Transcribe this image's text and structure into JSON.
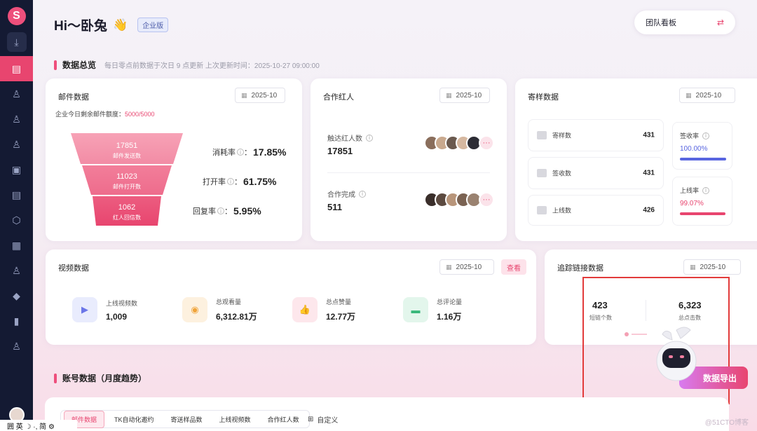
{
  "sidebar": {
    "logo": "S",
    "items": [
      {
        "icon": "download-icon",
        "glyph": "⤓"
      },
      {
        "icon": "dashboard-icon",
        "glyph": "▤"
      },
      {
        "icon": "user-icon",
        "glyph": "♙"
      },
      {
        "icon": "user-group-icon",
        "glyph": "♙"
      },
      {
        "icon": "user-search-icon",
        "glyph": "♙"
      },
      {
        "icon": "wallet-icon",
        "glyph": "▣"
      },
      {
        "icon": "document-icon",
        "glyph": "▤"
      },
      {
        "icon": "box-icon",
        "glyph": "⬡"
      },
      {
        "icon": "image-icon",
        "glyph": "▦"
      },
      {
        "icon": "person-star-icon",
        "glyph": "♙"
      },
      {
        "icon": "diamond-icon",
        "glyph": "◆"
      },
      {
        "icon": "chart-icon",
        "glyph": "▮"
      },
      {
        "icon": "profile-icon",
        "glyph": "♙"
      }
    ]
  },
  "header": {
    "greeting": "Hi～卧兔",
    "wave": "👋",
    "badge": "企业版",
    "team_select": "团队看板",
    "swap_icon": "⇄"
  },
  "overview": {
    "title": "数据总览",
    "subtitle": "每日零点前数据于次日 9 点更新 上次更新时间：2025-10-27 09:00:00"
  },
  "mail": {
    "title": "邮件数据",
    "date": "2025-10",
    "quota_label": "企业今日剩余邮件额度：",
    "quota_value": "5000/5000",
    "funnel": [
      {
        "value": "17851",
        "label": "邮件发送数"
      },
      {
        "value": "11023",
        "label": "邮件打开数"
      },
      {
        "value": "1062",
        "label": "红人回信数"
      }
    ],
    "rates": [
      {
        "label": "消耗率",
        "value": "17.85%"
      },
      {
        "label": "打开率",
        "value": "61.75%"
      },
      {
        "label": "回复率",
        "value": "5.95%"
      }
    ]
  },
  "kol": {
    "title": "合作红人",
    "date": "2025-10",
    "reached_label": "触达红人数",
    "reached_value": "17851",
    "completed_label": "合作完成",
    "completed_value": "511",
    "more": "···"
  },
  "sample": {
    "title": "寄样数据",
    "date": "2025-10",
    "stats": [
      {
        "label": "寄样数",
        "value": "431"
      },
      {
        "label": "签收数",
        "value": "431"
      },
      {
        "label": "上线数",
        "value": "426"
      }
    ],
    "rates": [
      {
        "label": "签收率",
        "value": "100.00%",
        "color": "#5865e0",
        "fill": 1.0
      },
      {
        "label": "上线率",
        "value": "99.07%",
        "color": "#e8456f",
        "fill": 0.9907
      }
    ]
  },
  "video": {
    "title": "视频数据",
    "date": "2025-10",
    "view_button": "查看",
    "stats": [
      {
        "label": "上线视频数",
        "value": "1,009",
        "icon": "video-icon",
        "glyph": "▶",
        "bg": "#e9ecfd",
        "fg": "#6b76e8"
      },
      {
        "label": "总观看量",
        "value": "6,312.81万",
        "icon": "eye-icon",
        "glyph": "◉",
        "bg": "#fdf1df",
        "fg": "#f0a43a"
      },
      {
        "label": "总点赞量",
        "value": "12.77万",
        "icon": "thumb-up-icon",
        "glyph": "👍",
        "bg": "#fde7ec",
        "fg": "#e8456f"
      },
      {
        "label": "总评论量",
        "value": "1.16万",
        "icon": "comment-icon",
        "glyph": "▬",
        "bg": "#e3f6ec",
        "fg": "#39b77a"
      }
    ]
  },
  "tracking": {
    "title": "追踪链接数据",
    "date": "2025-10",
    "short_links_value": "423",
    "short_links_label": "短链个数",
    "clicks_value": "6,323",
    "clicks_label": "总点击数"
  },
  "account": {
    "title": "账号数据（月度趋势）"
  },
  "export_button": "数据导出",
  "tabs": [
    "邮件数据",
    "TK自动化邀约",
    "寄送样品数",
    "上线视频数",
    "合作红人数"
  ],
  "custom_label": "自定义",
  "ime": "囲 英 ☽ ·, 简 ⚙",
  "watermark": "@51CTO博客"
}
